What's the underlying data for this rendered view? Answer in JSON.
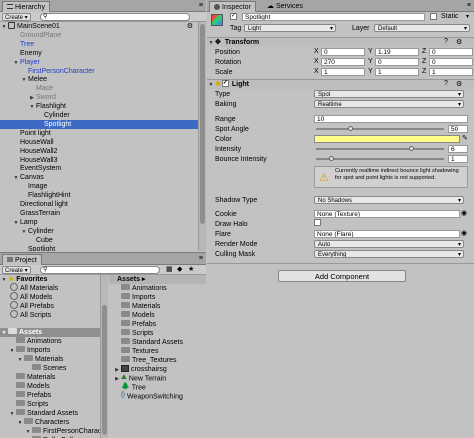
{
  "hierarchy": {
    "tab_label": "Hierarchy",
    "create_label": "Create",
    "search_icon": "search-icon",
    "scene_name": "MainScene01",
    "items": [
      {
        "label": "GroundPlane",
        "depth": 1,
        "style": "gray",
        "tri": ""
      },
      {
        "label": "Tree",
        "depth": 1,
        "style": "blue",
        "tri": ""
      },
      {
        "label": "Enemy",
        "depth": 1,
        "style": "",
        "tri": ""
      },
      {
        "label": "Player",
        "depth": 1,
        "style": "blue",
        "tri": "▼"
      },
      {
        "label": "FirstPersonCharacter",
        "depth": 2,
        "style": "blue",
        "tri": ""
      },
      {
        "label": "Melee",
        "depth": 2,
        "style": "",
        "tri": "▼"
      },
      {
        "label": "Mace",
        "depth": 3,
        "style": "gray",
        "tri": ""
      },
      {
        "label": "Sword",
        "depth": 3,
        "style": "gray",
        "tri": "▶"
      },
      {
        "label": "Flashlight",
        "depth": 3,
        "style": "",
        "tri": "▼"
      },
      {
        "label": "Cylinder",
        "depth": 4,
        "style": "",
        "tri": ""
      },
      {
        "label": "Spotlight",
        "depth": 4,
        "style": "sel",
        "tri": ""
      },
      {
        "label": "Point light",
        "depth": 1,
        "style": "",
        "tri": ""
      },
      {
        "label": "HouseWall",
        "depth": 1,
        "style": "",
        "tri": ""
      },
      {
        "label": "HouseWall2",
        "depth": 1,
        "style": "",
        "tri": ""
      },
      {
        "label": "HouseWall3",
        "depth": 1,
        "style": "",
        "tri": ""
      },
      {
        "label": "EventSystem",
        "depth": 1,
        "style": "",
        "tri": ""
      },
      {
        "label": "Canvas",
        "depth": 1,
        "style": "",
        "tri": "▼"
      },
      {
        "label": "Image",
        "depth": 2,
        "style": "",
        "tri": ""
      },
      {
        "label": "FlashlightHint",
        "depth": 2,
        "style": "",
        "tri": ""
      },
      {
        "label": "Directional light",
        "depth": 1,
        "style": "",
        "tri": ""
      },
      {
        "label": "GrassTerrain",
        "depth": 1,
        "style": "",
        "tri": ""
      },
      {
        "label": "Lamp",
        "depth": 1,
        "style": "",
        "tri": "▼"
      },
      {
        "label": "Cylinder",
        "depth": 2,
        "style": "",
        "tri": "▼"
      },
      {
        "label": "Cube",
        "depth": 3,
        "style": "",
        "tri": ""
      },
      {
        "label": "Spotlight",
        "depth": 2,
        "style": "",
        "tri": ""
      }
    ]
  },
  "project": {
    "tab_label": "Project",
    "create_label": "Create",
    "favorites_label": "Favorites",
    "favorites": [
      "All Materials",
      "All Models",
      "All Prefabs",
      "All Scripts"
    ],
    "assets_label": "Assets",
    "tree": [
      {
        "label": "Animations",
        "depth": 1,
        "tri": ""
      },
      {
        "label": "Imports",
        "depth": 1,
        "tri": "▼"
      },
      {
        "label": "Materials",
        "depth": 2,
        "tri": "▼"
      },
      {
        "label": "Scenes",
        "depth": 3,
        "tri": ""
      },
      {
        "label": "Materials",
        "depth": 1,
        "tri": ""
      },
      {
        "label": "Models",
        "depth": 1,
        "tri": ""
      },
      {
        "label": "Prefabs",
        "depth": 1,
        "tri": ""
      },
      {
        "label": "Scripts",
        "depth": 1,
        "tri": ""
      },
      {
        "label": "Standard Assets",
        "depth": 1,
        "tri": "▼"
      },
      {
        "label": "Characters",
        "depth": 2,
        "tri": "▼"
      },
      {
        "label": "FirstPersonCharact",
        "depth": 3,
        "tri": "▼"
      },
      {
        "label": "RollerBall",
        "depth": 3,
        "tri": ""
      }
    ],
    "breadcrumb": "Assets ▸",
    "assets": [
      {
        "label": "Animations",
        "icon": "folder"
      },
      {
        "label": "Imports",
        "icon": "folder"
      },
      {
        "label": "Materials",
        "icon": "folder"
      },
      {
        "label": "Models",
        "icon": "folder"
      },
      {
        "label": "Prefabs",
        "icon": "folder"
      },
      {
        "label": "Scripts",
        "icon": "folder"
      },
      {
        "label": "Standard Assets",
        "icon": "folder"
      },
      {
        "label": "Textures",
        "icon": "folder"
      },
      {
        "label": "Tree_Textures",
        "icon": "folder"
      },
      {
        "label": "crosshairsg",
        "icon": "image"
      },
      {
        "label": "New Terrain",
        "icon": "terrain"
      },
      {
        "label": "Tree",
        "icon": "tree"
      },
      {
        "label": "WeaponSwitching",
        "icon": "script"
      }
    ]
  },
  "inspector": {
    "tab_label": "Inspector",
    "services_label": "Services",
    "object_name": "Spotlight",
    "static_label": "Static",
    "tag_label": "Tag",
    "tag_value": "Light",
    "layer_label": "Layer",
    "layer_value": "Default",
    "transform": {
      "title": "Transform",
      "rows": [
        {
          "label": "Position",
          "x": "0",
          "y": "1.19",
          "z": "0"
        },
        {
          "label": "Rotation",
          "x": "270",
          "y": "0",
          "z": "0"
        },
        {
          "label": "Scale",
          "x": "1",
          "y": "1",
          "z": "1"
        }
      ]
    },
    "light": {
      "title": "Light",
      "type_label": "Type",
      "type_value": "Spot",
      "baking_label": "Baking",
      "baking_value": "Realtime",
      "range_label": "Range",
      "range_value": "10",
      "spot_angle_label": "Spot Angle",
      "spot_angle_value": "50",
      "spot_angle_fraction": 0.27,
      "color_label": "Color",
      "intensity_label": "Intensity",
      "intensity_value": "6",
      "intensity_fraction": 0.75,
      "bounce_label": "Bounce Intensity",
      "bounce_value": "1",
      "bounce_fraction": 0.125,
      "warning": "Currently realtime indirect bounce light shadowing for spot and point lights is not supported.",
      "shadow_label": "Shadow Type",
      "shadow_value": "No Shadows",
      "cookie_label": "Cookie",
      "cookie_value": "None (Texture)",
      "draw_halo_label": "Draw Halo",
      "flare_label": "Flare",
      "flare_value": "None (Flare)",
      "render_mode_label": "Render Mode",
      "render_mode_value": "Auto",
      "culling_label": "Culling Mask",
      "culling_value": "Everything"
    },
    "add_component_label": "Add Component",
    "colors": {
      "selection": "#3d6ac5",
      "prefab_blue": "#1f3fc7",
      "color_swatch": "#ffff88"
    }
  }
}
